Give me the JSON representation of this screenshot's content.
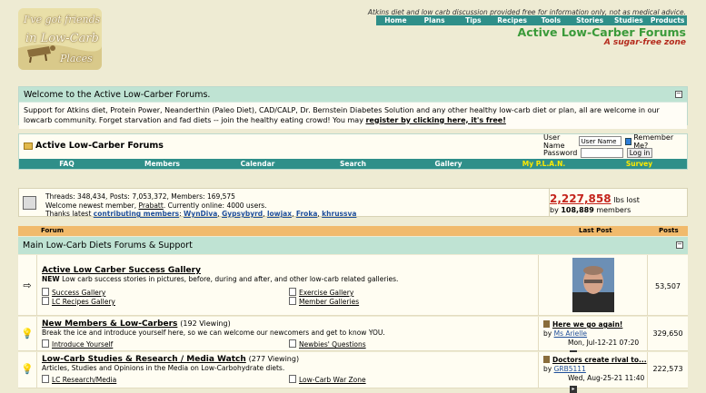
{
  "logo": {
    "line1": "I've got friends",
    "line2": "in Low-Carb",
    "line3": "Places"
  },
  "header": {
    "tagline": "Atkins diet and low carb discussion provided free for information only, not as medical advice.",
    "nav": [
      "Home",
      "Plans",
      "Tips",
      "Recipes",
      "Tools",
      "Stories",
      "Studies",
      "Products"
    ],
    "title": "Active Low-Carber Forums",
    "subtitle": "A sugar-free zone"
  },
  "welcome": {
    "heading": "Welcome to the Active Low-Carber Forums.",
    "body": "Support for Atkins diet, Protein Power, Neanderthin (Paleo Diet), CAD/CALP, Dr. Bernstein Diabetes Solution and any other healthy low-carb diet or plan, all are welcome in our lowcarb community. Forget starvation and fad diets -- join the healthy eating crowd! You may ",
    "register_link": "register by clicking here, it's free!"
  },
  "breadcrumb": {
    "label": "Active Low-Carber Forums"
  },
  "login": {
    "username_label": "User Name",
    "username_value": "User Name",
    "remember_label": "Remember Me?",
    "password_label": "Password",
    "login_button": "Log in"
  },
  "subnav": [
    "FAQ",
    "Members",
    "Calendar",
    "Search",
    "Gallery",
    "My P.L.A.N.",
    "Survey"
  ],
  "stats": {
    "line1": "Threads: 348,434, Posts: 7,053,372, Members: 169,575",
    "line2_prefix": "Welcome newest member, ",
    "newest_member": "Prabatt",
    "line2_suffix": ". Currently online: 4000 users.",
    "line3_prefix": "Thanks latest ",
    "contributing_label": "contributing members",
    "contributors": [
      "WynDiva",
      "Gypsybyrd",
      "lowjax",
      "Froka",
      "khrussva"
    ],
    "lost_value": "2,227,858",
    "lost_unit": "lbs lost",
    "by_prefix": "by",
    "members_count": "108,889",
    "members_label": "members"
  },
  "columns": {
    "forum": "Forum",
    "last_post": "Last Post",
    "posts": "Posts"
  },
  "category": {
    "title": "Main Low-Carb Diets Forums & Support"
  },
  "forums": [
    {
      "title": "Active Low Carber Success Gallery",
      "viewing": "",
      "desc_bold": "NEW",
      "desc": " Low carb success stories in pictures, before, during and after, and other low-carb related galleries.",
      "subs": [
        "Success Gallery",
        "Exercise Gallery",
        "LC Recipes Gallery",
        "Member Galleries"
      ],
      "posts": "53,507"
    },
    {
      "title": "New Members & Low-Carbers",
      "viewing": "(192 Viewing)",
      "desc_bold": "",
      "desc": "Break the ice and introduce yourself here, so we can welcome our newcomers and get to know YOU.",
      "subs": [
        "Introduce Yourself",
        "Newbies' Questions"
      ],
      "last_title": "Here we go again!",
      "last_by": "by",
      "last_user": "Ms Arielle",
      "last_date": "Mon, Jul-12-21 07:20",
      "posts": "329,650"
    },
    {
      "title": "Low-Carb Studies & Research / Media Watch",
      "viewing": "(277 Viewing)",
      "desc_bold": "",
      "desc": "Articles, Studies and Opinions in the Media on Low-Carbohydrate diets.",
      "subs": [
        "LC Research/Media",
        "Low-Carb War Zone"
      ],
      "last_title": "Doctors create rival to...",
      "last_by": "by",
      "last_user": "GRB5111",
      "last_date": "Wed, Aug-25-21 11:40",
      "posts": "222,573"
    }
  ]
}
